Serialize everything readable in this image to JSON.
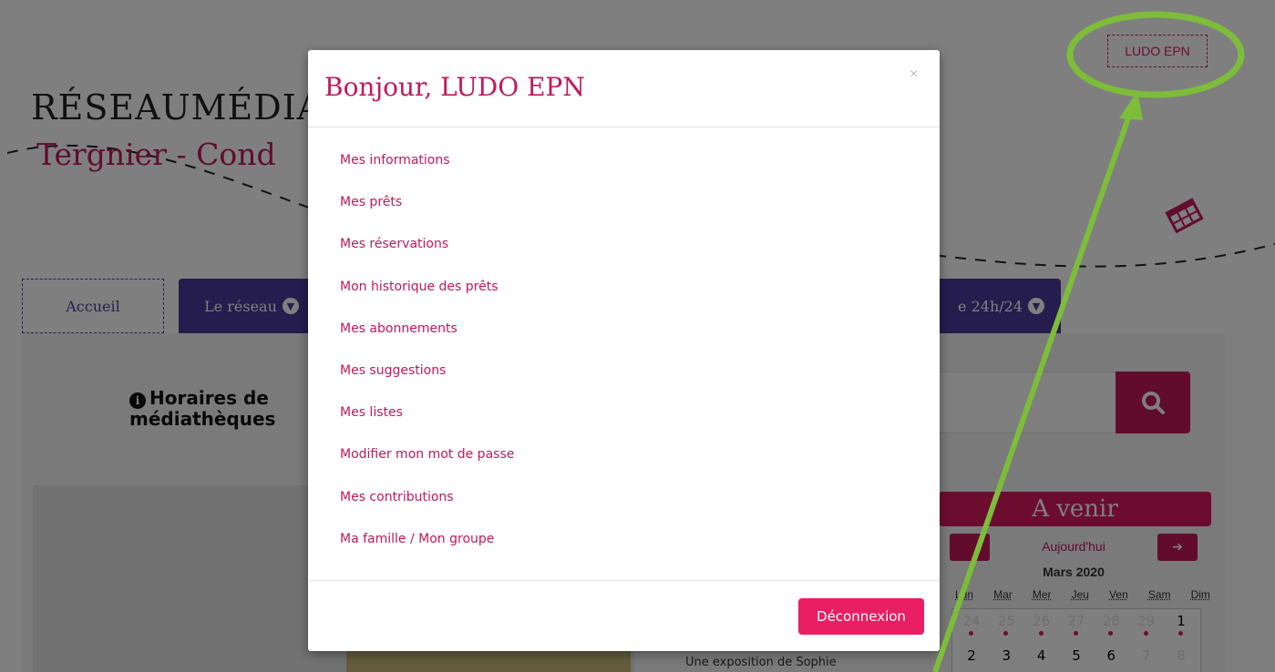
{
  "logo": {
    "line1": "RÉSEAUMÉDIA",
    "line2": "Tergnier - Cond"
  },
  "header": {
    "login_label": "LUDO EPN"
  },
  "nav": {
    "accueil": "Accueil",
    "reseau": "Le réseau",
    "h24": "e 24h/24"
  },
  "horaires": {
    "line1": "Horaires de",
    "line2": "médiathèques"
  },
  "agenda": {
    "title": "A venir",
    "today": "Aujourd'hui",
    "month": "Mars 2020",
    "weekdays": [
      "Lun",
      "Mar",
      "Mer",
      "Jeu",
      "Ven",
      "Sam",
      "Dim"
    ],
    "row1": [
      "24",
      "25",
      "26",
      "27",
      "28",
      "29",
      "1"
    ],
    "row2": [
      "2",
      "3",
      "4",
      "5",
      "6",
      "7",
      "8"
    ]
  },
  "event": {
    "text": "Une exposition de Sophie"
  },
  "modal": {
    "title": "Bonjour, LUDO EPN",
    "close": "×",
    "items": [
      "Mes informations",
      "Mes prêts",
      "Mes réservations",
      "Mon historique des prêts",
      "Mes abonnements",
      "Mes suggestions",
      "Mes listes",
      "Modifier mon mot de passe",
      "Mes contributions",
      "Ma famille / Mon groupe"
    ],
    "logout": "Déconnexion"
  },
  "colors": {
    "accent": "#c2185b",
    "nav": "#4a3a9a",
    "annotation": "#7dbd3a"
  }
}
